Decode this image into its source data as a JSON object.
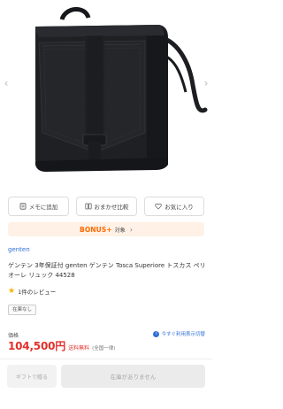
{
  "gallery": {
    "image_alt": "black leather backpack",
    "prev_icon": "chevron-left-icon",
    "next_icon": "chevron-right-icon"
  },
  "actions": {
    "memo": {
      "label": "メモに追加",
      "icon": "memo-icon"
    },
    "omakase": {
      "label": "おまかせ比較",
      "icon": "compare-icon"
    },
    "favorite": {
      "label": "お気に入り",
      "icon": "heart-icon"
    }
  },
  "bonus": {
    "label": "BONUS+",
    "sub": "対象",
    "chevron": "›"
  },
  "product": {
    "brand": "genten",
    "title": "ゲンテン 3年保証付 genten ゲンテン Tosca Superiore トスカス ペリオーレ リュック 44528",
    "review_star": "★",
    "review_text": "1件のレビュー",
    "stock_badge": "在庫なし"
  },
  "price": {
    "label": "価格",
    "value": "104,500円",
    "shipping": "送料無料",
    "shipping_note": "(全国一律)",
    "usage_link": "今すぐ利用表示切替",
    "usage_icon": "info-icon"
  },
  "bottom": {
    "gift_label": "ギフトで贈る",
    "soldout_label": "在庫がありません"
  },
  "colors": {
    "accent_blue": "#2d6fd6",
    "price_red": "#e3302b",
    "bonus_orange": "#ff6a00",
    "star_yellow": "#f5b400"
  }
}
